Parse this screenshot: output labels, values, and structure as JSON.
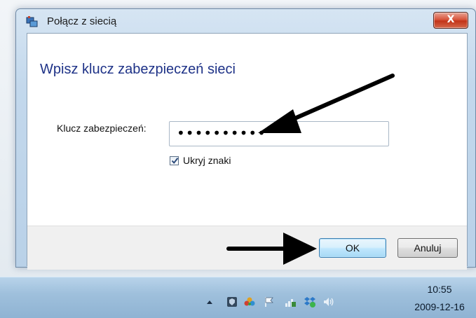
{
  "window": {
    "title": "Połącz z siecią",
    "close_label": "X"
  },
  "dialog": {
    "heading": "Wpisz klucz zabezpieczeń sieci",
    "key_label": "Klucz zabezpieczeń:",
    "key_value": "••••••••••",
    "hide_chars_label": "Ukryj znaki",
    "hide_chars_checked": true,
    "ok_label": "OK",
    "cancel_label": "Anuluj"
  },
  "taskbar": {
    "time": "10:55",
    "date": "2009-12-16",
    "tray_icons": [
      "show-hidden-icons-icon",
      "shield-app-icon",
      "flower-app-icon",
      "action-center-flag-icon",
      "network-icon",
      "dropbox-icon",
      "volume-icon"
    ]
  },
  "colors": {
    "heading": "#1e3287",
    "close_button": "#c23419",
    "ok_border": "#3c7fb1"
  }
}
